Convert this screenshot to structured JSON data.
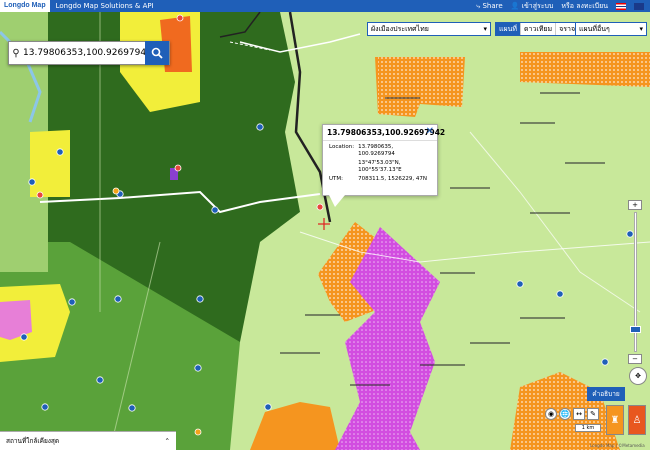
{
  "header": {
    "logo": "Longdo Map",
    "title": "Longdo Map Solutions & API",
    "share": "Share",
    "help": "เข้าสู่ระบบ",
    "login": "หรือ ลงทะเบียน"
  },
  "search": {
    "value": "13.79806353,100.92697942"
  },
  "layers": {
    "select_label": "ผังเมืองประเทศไทย",
    "map_types": [
      "แผนที่",
      "ดาวเทียม",
      "จราจร"
    ],
    "layer_list_label": "แผนที่อื่นๆ"
  },
  "popup": {
    "title": "13.79806353,100.92697942",
    "location_label": "Location:",
    "location_value": "13.7980635, 100.9269794",
    "dms_lat": "13°47'53.03\"N,",
    "dms_lon": "100°55'37.13\"E",
    "utm_label": "UTM:",
    "utm_value": "708311.5, 1526229, 47N"
  },
  "bottom": {
    "nearby_label": "สถานที่ใกล้เคียงสุด",
    "help_button": "คำอธิบาย",
    "scale": "1 km",
    "credit": "Longdo Map | ©Metamedia"
  },
  "colors": {
    "header": "#1f5fb8",
    "lightgreen": "#c8e89a",
    "darkgreen": "#2f6b1e",
    "midgreen": "#5aa23a",
    "orange": "#f5951f",
    "magenta": "#d24de0",
    "yellow": "#f2ee3a"
  }
}
